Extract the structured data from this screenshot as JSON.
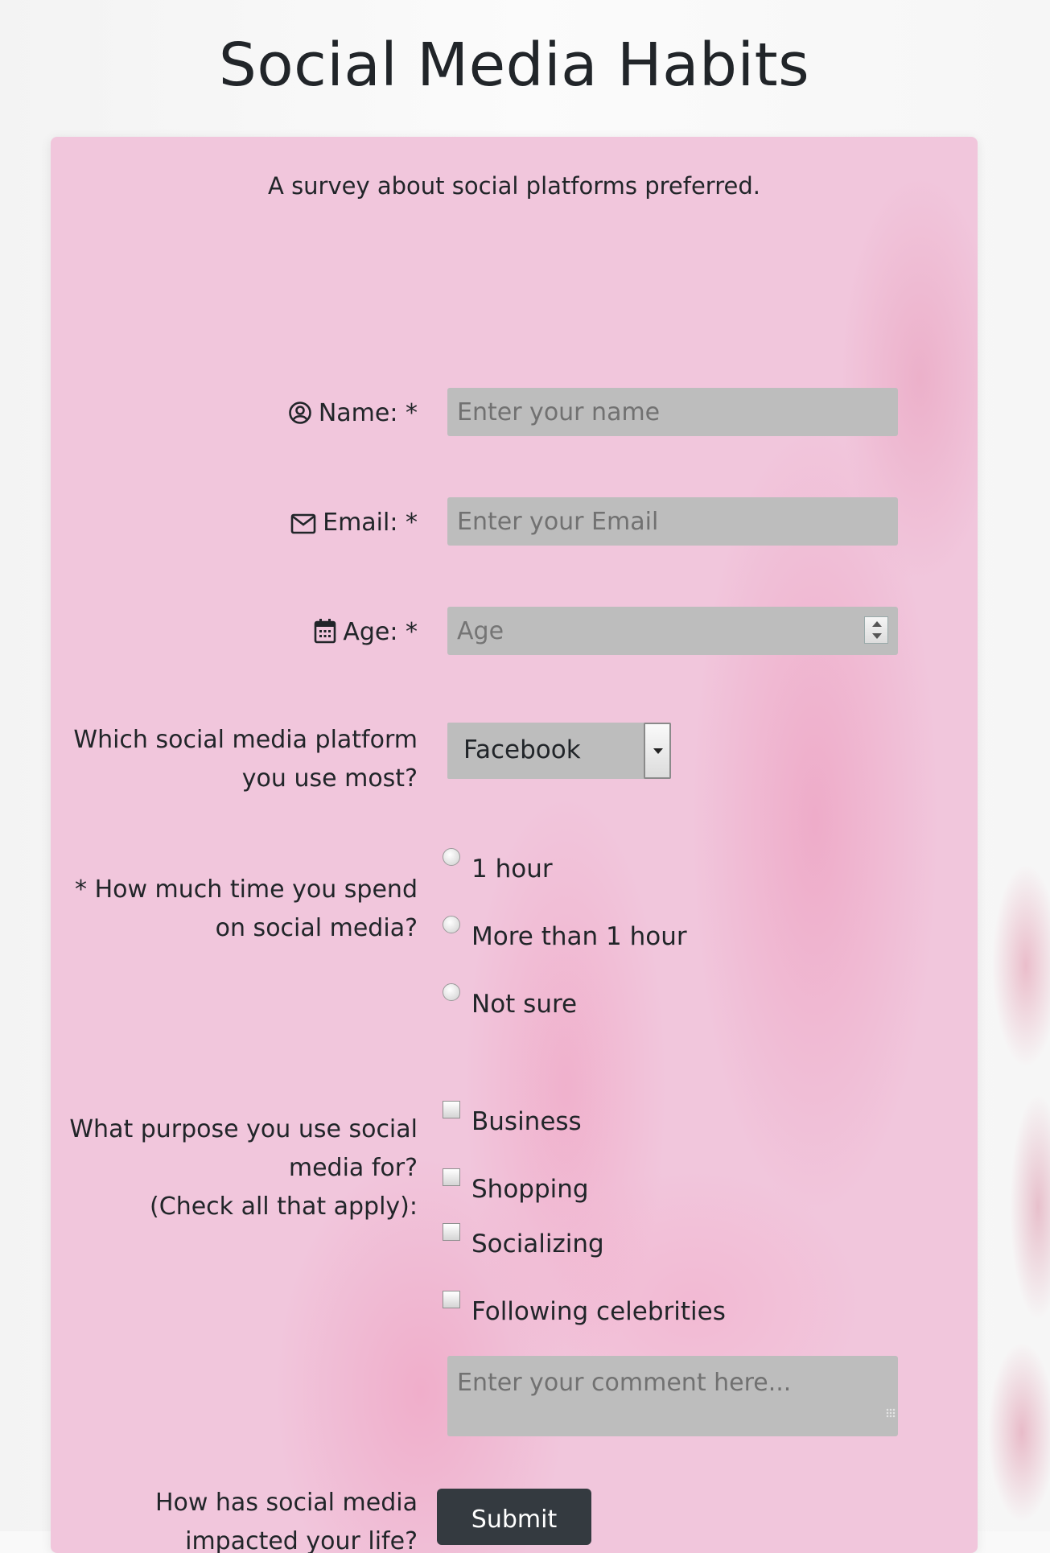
{
  "page": {
    "title": "Social Media Habits",
    "description": "A survey about social platforms preferred."
  },
  "form": {
    "name": {
      "label": "Name: *",
      "placeholder": "Enter your name",
      "icon": "user-circle-icon"
    },
    "email": {
      "label": "Email: *",
      "placeholder": "Enter your Email",
      "icon": "envelope-icon"
    },
    "age": {
      "label": "Age: *",
      "placeholder": "Age",
      "icon": "calendar-icon"
    },
    "platform": {
      "label_line1": "Which social media platform",
      "label_line2": "you use most?",
      "selected": "Facebook"
    },
    "time": {
      "label_line1": "* How much time you spend",
      "label_line2": "on social media?",
      "options": [
        "1 hour",
        "More than 1 hour",
        "Not sure"
      ]
    },
    "purpose": {
      "label_line1": "What purpose you use social",
      "label_line2": "media for?",
      "label_line3": "(Check all that apply):",
      "options": [
        "Business",
        "Shopping",
        "Socializing",
        "Following celebrities"
      ]
    },
    "impact": {
      "label_line1": "How has social media",
      "label_line2": "impacted your life?",
      "placeholder": "Enter your comment here..."
    },
    "submit_label": "Submit"
  },
  "colors": {
    "card": "#f1c6dc",
    "field": "#bdbdbd",
    "button": "#343a40"
  }
}
